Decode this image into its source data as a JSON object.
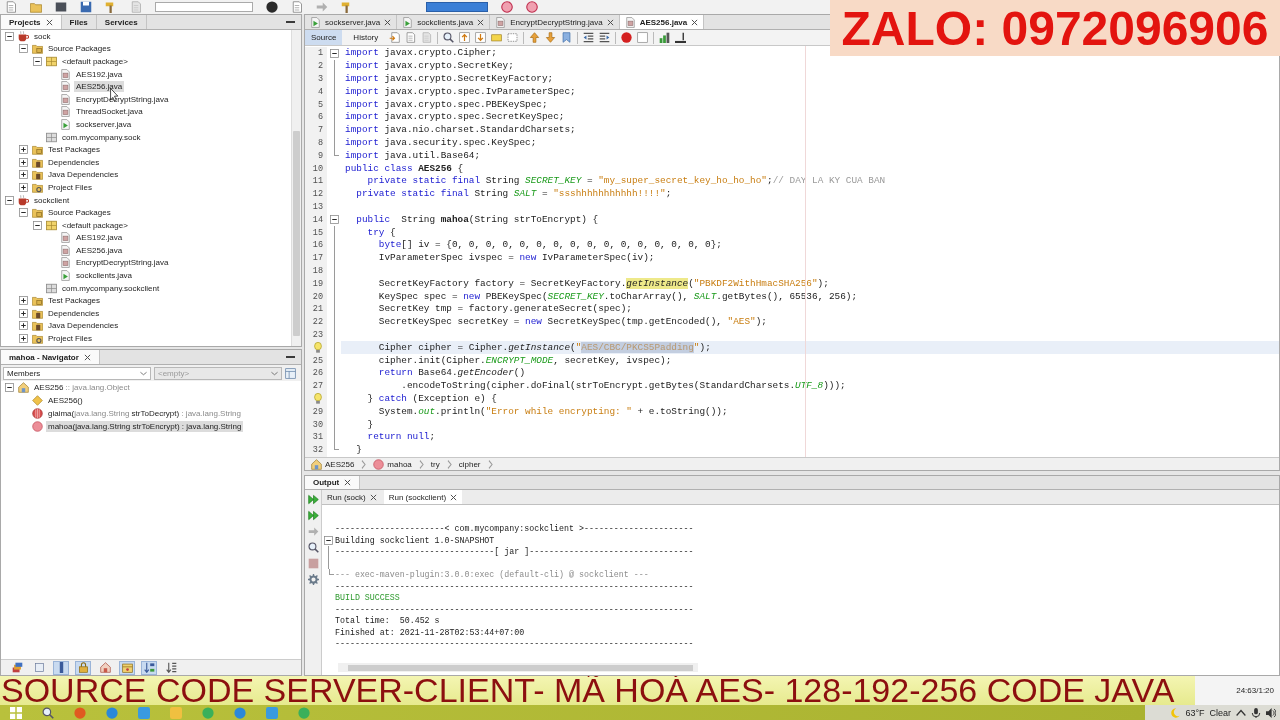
{
  "overlay": {
    "contact": "ZALO: 0972096906",
    "caption": "SOURCE CODE SERVER-CLIENT- MÃ HOÁ AES- 128-192-256 CODE JAVA"
  },
  "projects": {
    "tabs": [
      {
        "label": "Projects",
        "selected": true,
        "closable": true
      },
      {
        "label": "Files",
        "selected": false,
        "closable": false
      },
      {
        "label": "Services",
        "selected": false,
        "closable": false
      }
    ],
    "tree": [
      {
        "label": "sock",
        "kind": "project",
        "expanded": true,
        "selected": false,
        "children": [
          {
            "label": "Source Packages",
            "kind": "source-folder",
            "expanded": true,
            "selected": false,
            "children": [
              {
                "label": "<default package>",
                "kind": "package",
                "expanded": true,
                "selected": false,
                "children": [
                  {
                    "label": "AES192.java",
                    "kind": "class-file",
                    "selected": false
                  },
                  {
                    "label": "AES256.java",
                    "kind": "class-file",
                    "selected": true
                  },
                  {
                    "label": "EncryptDecryptString.java",
                    "kind": "class-file",
                    "selected": false
                  },
                  {
                    "label": "ThreadSocket.java",
                    "kind": "class-file",
                    "selected": false
                  },
                  {
                    "label": "sockserver.java",
                    "kind": "main-file",
                    "selected": false
                  }
                ]
              },
              {
                "label": "com.mycompany.sock",
                "kind": "empty-package",
                "selected": false
              }
            ]
          },
          {
            "label": "Test Packages",
            "kind": "test-folder",
            "expanded": false,
            "selected": false
          },
          {
            "label": "Dependencies",
            "kind": "dependencies",
            "expanded": false,
            "selected": false
          },
          {
            "label": "Java Dependencies",
            "kind": "dependencies",
            "expanded": false,
            "selected": false
          },
          {
            "label": "Project Files",
            "kind": "project-files",
            "expanded": false,
            "selected": false
          }
        ]
      },
      {
        "label": "sockclient",
        "kind": "project",
        "expanded": true,
        "selected": false,
        "children": [
          {
            "label": "Source Packages",
            "kind": "source-folder",
            "expanded": true,
            "selected": false,
            "children": [
              {
                "label": "<default package>",
                "kind": "package",
                "expanded": true,
                "selected": false,
                "children": [
                  {
                    "label": "AES192.java",
                    "kind": "class-file",
                    "selected": false
                  },
                  {
                    "label": "AES256.java",
                    "kind": "class-file",
                    "selected": false
                  },
                  {
                    "label": "EncryptDecryptString.java",
                    "kind": "class-file",
                    "selected": false
                  },
                  {
                    "label": "sockclients.java",
                    "kind": "main-file",
                    "selected": false
                  }
                ]
              },
              {
                "label": "com.mycompany.sockclient",
                "kind": "empty-package",
                "selected": false
              }
            ]
          },
          {
            "label": "Test Packages",
            "kind": "test-folder",
            "expanded": false,
            "selected": false
          },
          {
            "label": "Dependencies",
            "kind": "dependencies",
            "expanded": false,
            "selected": false
          },
          {
            "label": "Java Dependencies",
            "kind": "dependencies",
            "expanded": false,
            "selected": false
          },
          {
            "label": "Project Files",
            "kind": "project-files",
            "expanded": false,
            "selected": false
          }
        ]
      }
    ]
  },
  "navigator": {
    "title": "mahoa - Navigator",
    "closable": true,
    "filter": "Members",
    "scope": {
      "value": "<empty>",
      "disabled": true
    },
    "tree": [
      {
        "kind": "class",
        "expanded": true,
        "selected": false,
        "segments": [
          {
            "kind": "name",
            "text": "AES256"
          },
          {
            "kind": "type",
            "text": " :: java.lang.Object"
          }
        ],
        "children": [
          {
            "kind": "constructor",
            "selected": false,
            "segments": [
              {
                "kind": "name",
                "text": "AES256()"
              }
            ]
          },
          {
            "kind": "private-method",
            "selected": false,
            "segments": [
              {
                "kind": "name",
                "text": "giaima("
              },
              {
                "kind": "type",
                "text": "java.lang.String"
              },
              {
                "kind": "name",
                "text": " strToDecrypt)"
              },
              {
                "kind": "type",
                "text": " : java.lang.String"
              }
            ]
          },
          {
            "kind": "method",
            "selected": true,
            "segments": [
              {
                "kind": "name",
                "text": "mahoa(java.lang.String strToEncrypt) : java.lang.String"
              }
            ]
          }
        ]
      }
    ],
    "filters": [
      {
        "kind": "inherited",
        "on": false
      },
      {
        "kind": "fields",
        "on": false
      },
      {
        "kind": "static",
        "on": true
      },
      {
        "kind": "non-public",
        "on": true
      },
      {
        "kind": "inner-classes",
        "on": false
      },
      {
        "kind": "javadoc",
        "on": true
      },
      {
        "kind": "sort-name",
        "on": true
      },
      {
        "kind": "sort-source",
        "on": false
      }
    ]
  },
  "editor": {
    "tabs": [
      {
        "label": "sockserver.java",
        "kind": "main-file",
        "selected": false
      },
      {
        "label": "sockclients.java",
        "kind": "main-file",
        "selected": false
      },
      {
        "label": "EncryptDecryptString.java",
        "kind": "class-file",
        "selected": false
      },
      {
        "label": "AES256.java",
        "kind": "class-file",
        "selected": true
      }
    ],
    "views": [
      {
        "label": "Source",
        "selected": true
      },
      {
        "label": "History",
        "selected": false
      }
    ],
    "lines": [
      {
        "number": "1",
        "fold_open": true,
        "current": false,
        "tokens": [
          {
            "kind": "keyword",
            "text": "import"
          },
          {
            "kind": "plain",
            "text": " javax.crypto.Cipher;"
          }
        ]
      },
      {
        "number": "2",
        "in_fold": true,
        "current": false,
        "tokens": [
          {
            "kind": "keyword",
            "text": "import"
          },
          {
            "kind": "plain",
            "text": " javax.crypto.SecretKey;"
          }
        ]
      },
      {
        "number": "3",
        "in_fold": true,
        "current": false,
        "tokens": [
          {
            "kind": "keyword",
            "text": "import"
          },
          {
            "kind": "plain",
            "text": " javax.crypto.SecretKeyFactory;"
          }
        ]
      },
      {
        "number": "4",
        "in_fold": true,
        "current": false,
        "tokens": [
          {
            "kind": "keyword",
            "text": "import"
          },
          {
            "kind": "plain",
            "text": " javax.crypto.spec.IvParameterSpec;"
          }
        ]
      },
      {
        "number": "5",
        "in_fold": true,
        "current": false,
        "tokens": [
          {
            "kind": "keyword",
            "text": "import"
          },
          {
            "kind": "plain",
            "text": " javax.crypto.spec.PBEKeySpec;"
          }
        ]
      },
      {
        "number": "6",
        "in_fold": true,
        "current": false,
        "tokens": [
          {
            "kind": "keyword",
            "text": "import"
          },
          {
            "kind": "plain",
            "text": " javax.crypto.spec.SecretKeySpec;"
          }
        ]
      },
      {
        "number": "7",
        "in_fold": true,
        "current": false,
        "tokens": [
          {
            "kind": "keyword",
            "text": "import"
          },
          {
            "kind": "plain",
            "text": " java.nio.charset.StandardCharsets;"
          }
        ]
      },
      {
        "number": "8",
        "in_fold": true,
        "current": false,
        "tokens": [
          {
            "kind": "keyword",
            "text": "import"
          },
          {
            "kind": "plain",
            "text": " java.security.spec.KeySpec;"
          }
        ]
      },
      {
        "number": "9",
        "in_fold": true,
        "current": false,
        "tokens": [
          {
            "kind": "keyword",
            "text": "import"
          },
          {
            "kind": "plain",
            "text": " java.util.Base64;"
          }
        ]
      },
      {
        "number": "10",
        "current": false,
        "tokens": [
          {
            "kind": "keyword",
            "text": "public"
          },
          {
            "kind": "keyword",
            "text": " class"
          },
          {
            "kind": "bold",
            "text": " AES256"
          },
          {
            "kind": "plain",
            "text": " {"
          }
        ]
      },
      {
        "number": "11",
        "current": false,
        "tokens": [
          {
            "kind": "keyword",
            "text": "    private"
          },
          {
            "kind": "keyword",
            "text": " static"
          },
          {
            "kind": "keyword",
            "text": " final"
          },
          {
            "kind": "plain",
            "text": " String "
          },
          {
            "kind": "field",
            "text": "SECRET_KEY"
          },
          {
            "kind": "plain",
            "text": " = "
          },
          {
            "kind": "string",
            "text": "\"my_super_secret_key_ho_ho_ho\""
          },
          {
            "kind": "plain",
            "text": ";"
          },
          {
            "kind": "comment",
            "text": "// DAY LA KY CUA BAN"
          }
        ]
      },
      {
        "number": "12",
        "current": false,
        "tokens": [
          {
            "kind": "keyword",
            "text": "  private"
          },
          {
            "kind": "keyword",
            "text": " static"
          },
          {
            "kind": "keyword",
            "text": " final"
          },
          {
            "kind": "plain",
            "text": " String "
          },
          {
            "kind": "field",
            "text": "SALT"
          },
          {
            "kind": "plain",
            "text": " = "
          },
          {
            "kind": "string",
            "text": "\"ssshhhhhhhhhhh!!!!\""
          },
          {
            "kind": "plain",
            "text": ";"
          }
        ]
      },
      {
        "number": "13",
        "current": false
      },
      {
        "number": "14",
        "fold_open": true,
        "current": false,
        "tokens": [
          {
            "kind": "keyword",
            "text": "  public"
          },
          {
            "kind": "plain",
            "text": "  String "
          },
          {
            "kind": "bold",
            "text": "mahoa"
          },
          {
            "kind": "plain",
            "text": "(String strToEncrypt) {"
          }
        ]
      },
      {
        "number": "15",
        "in_fold": true,
        "current": false,
        "tokens": [
          {
            "kind": "keyword",
            "text": "    try"
          },
          {
            "kind": "plain",
            "text": " {"
          }
        ]
      },
      {
        "number": "16",
        "in_fold": true,
        "current": false,
        "tokens": [
          {
            "kind": "keyword",
            "text": "      byte"
          },
          {
            "kind": "plain",
            "text": "[] iv = {0, 0, 0, 0, 0, 0, 0, 0, 0, 0, 0, 0, 0, 0, 0, 0};"
          }
        ]
      },
      {
        "number": "17",
        "in_fold": true,
        "current": false,
        "tokens": [
          {
            "kind": "plain",
            "text": "      IvParameterSpec ivspec = "
          },
          {
            "kind": "keyword",
            "text": "new"
          },
          {
            "kind": "plain",
            "text": " IvParameterSpec(iv);"
          }
        ]
      },
      {
        "number": "18",
        "in_fold": true,
        "current": false
      },
      {
        "number": "19",
        "in_fold": true,
        "current": false,
        "tokens": [
          {
            "kind": "plain",
            "text": "      SecretKeyFactory factory = SecretKeyFactory."
          },
          {
            "kind": "occurrence",
            "text": "getInstance"
          },
          {
            "kind": "plain",
            "text": "("
          },
          {
            "kind": "string",
            "text": "\"PBKDF2WithHmacSHA256\""
          },
          {
            "kind": "plain",
            "text": ");"
          }
        ]
      },
      {
        "number": "20",
        "in_fold": true,
        "current": false,
        "tokens": [
          {
            "kind": "plain",
            "text": "      KeySpec spec = "
          },
          {
            "kind": "keyword",
            "text": "new"
          },
          {
            "kind": "plain",
            "text": " PBEKeySpec("
          },
          {
            "kind": "field",
            "text": "SECRET_KEY"
          },
          {
            "kind": "plain",
            "text": ".toCharArray(), "
          },
          {
            "kind": "field",
            "text": "SALT"
          },
          {
            "kind": "plain",
            "text": ".getBytes(), 65536, 256);"
          }
        ]
      },
      {
        "number": "21",
        "in_fold": true,
        "current": false,
        "tokens": [
          {
            "kind": "plain",
            "text": "      SecretKey tmp = factory.generateSecret(spec);"
          }
        ]
      },
      {
        "number": "22",
        "in_fold": true,
        "current": false,
        "tokens": [
          {
            "kind": "plain",
            "text": "      SecretKeySpec secretKey = "
          },
          {
            "kind": "keyword",
            "text": "new"
          },
          {
            "kind": "plain",
            "text": " SecretKeySpec(tmp.getEncoded(), "
          },
          {
            "kind": "string",
            "text": "\"AES\""
          },
          {
            "kind": "plain",
            "text": ");"
          }
        ]
      },
      {
        "number": "23",
        "in_fold": true,
        "current": false
      },
      {
        "hint": true,
        "in_fold": true,
        "current": true,
        "tokens": [
          {
            "kind": "plain",
            "text": "      Cipher cipher = Cipher."
          },
          {
            "kind": "italic",
            "text": "getInstance"
          },
          {
            "kind": "plain",
            "text": "("
          },
          {
            "kind": "string",
            "text": "\""
          },
          {
            "kind": "selection",
            "text": "AES/CBC/PKCS5Padding"
          },
          {
            "kind": "string",
            "text": "\""
          },
          {
            "kind": "plain",
            "text": ");"
          }
        ]
      },
      {
        "number": "25",
        "in_fold": true,
        "current": false,
        "tokens": [
          {
            "kind": "plain",
            "text": "      cipher.init(Cipher."
          },
          {
            "kind": "field",
            "text": "ENCRYPT_MODE"
          },
          {
            "kind": "plain",
            "text": ", secretKey, ivspec);"
          }
        ]
      },
      {
        "number": "26",
        "in_fold": true,
        "current": false,
        "tokens": [
          {
            "kind": "keyword",
            "text": "      return"
          },
          {
            "kind": "plain",
            "text": " Base64."
          },
          {
            "kind": "italic",
            "text": "getEncoder"
          },
          {
            "kind": "plain",
            "text": "()"
          }
        ]
      },
      {
        "number": "27",
        "in_fold": true,
        "current": false,
        "tokens": [
          {
            "kind": "plain",
            "text": "          .encodeToString(cipher.doFinal(strToEncrypt.getBytes(StandardCharsets."
          },
          {
            "kind": "field",
            "text": "UTF_8"
          },
          {
            "kind": "plain",
            "text": ")));"
          }
        ]
      },
      {
        "hint": true,
        "in_fold": true,
        "current": false,
        "tokens": [
          {
            "kind": "plain",
            "text": "    } "
          },
          {
            "kind": "keyword",
            "text": "catch"
          },
          {
            "kind": "plain",
            "text": " (Exception e) {"
          }
        ]
      },
      {
        "number": "29",
        "in_fold": true,
        "current": false,
        "tokens": [
          {
            "kind": "plain",
            "text": "      System."
          },
          {
            "kind": "field",
            "text": "out"
          },
          {
            "kind": "plain",
            "text": ".println("
          },
          {
            "kind": "string",
            "text": "\"Error while encrypting: \""
          },
          {
            "kind": "plain",
            "text": " + e.toString());"
          }
        ]
      },
      {
        "number": "30",
        "in_fold": true,
        "current": false,
        "tokens": [
          {
            "kind": "plain",
            "text": "    }"
          }
        ]
      },
      {
        "number": "31",
        "in_fold": true,
        "current": false,
        "tokens": [
          {
            "kind": "keyword",
            "text": "    return"
          },
          {
            "kind": "keyword",
            "text": " null"
          },
          {
            "kind": "plain",
            "text": ";"
          }
        ]
      },
      {
        "number": "32",
        "in_fold": true,
        "current": false,
        "tokens": [
          {
            "kind": "plain",
            "text": "  }"
          }
        ]
      }
    ],
    "breadcrumbs": [
      {
        "label": "AES256",
        "kind": "class"
      },
      {
        "label": "mahoa",
        "kind": "method"
      },
      {
        "label": "try",
        "kind": "block"
      },
      {
        "label": "cipher",
        "kind": "block"
      }
    ]
  },
  "output": {
    "title": "Output",
    "closable": true,
    "tabs": [
      {
        "label": "Run (sock)",
        "selected": false
      },
      {
        "label": "Run (sockclient)",
        "selected": true
      }
    ],
    "lines": [
      {
        "kind": "plain",
        "text": "----------------------< com.mycompany:sockclient >----------------------"
      },
      {
        "kind": "plain",
        "fold_open": true,
        "text": "Building sockclient 1.0-SNAPSHOT"
      },
      {
        "kind": "plain",
        "in_fold": true,
        "text": "--------------------------------[ jar ]---------------------------------"
      },
      {
        "kind": "blank",
        "in_fold": true
      },
      {
        "kind": "muted",
        "in_fold": true,
        "text": "--- exec-maven-plugin:3.0.0:exec (default-cli) @ sockclient ---"
      },
      {
        "kind": "plain",
        "text": "------------------------------------------------------------------------"
      },
      {
        "kind": "success",
        "text": "BUILD SUCCESS"
      },
      {
        "kind": "plain",
        "text": "------------------------------------------------------------------------"
      },
      {
        "kind": "plain",
        "text": "Total time:  50.452 s"
      },
      {
        "kind": "plain",
        "text": "Finished at: 2021-11-28T02:53:44+07:00"
      },
      {
        "kind": "plain",
        "text": "------------------------------------------------------------------------"
      }
    ]
  },
  "status": {
    "position": "24:63/1:20"
  },
  "taskbar": {
    "temperature": "63°F",
    "weather": "Clear"
  }
}
